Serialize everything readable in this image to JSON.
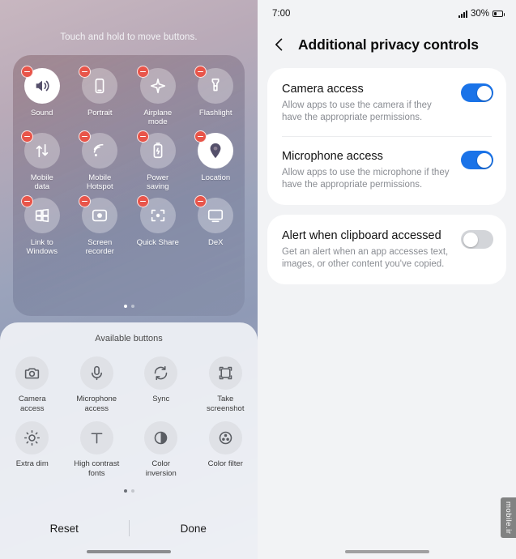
{
  "left_panel": {
    "hint": "Touch and hold to move buttons.",
    "quick_tiles": [
      {
        "label": "Sound",
        "icon": "sound-icon",
        "active": true,
        "removable": true
      },
      {
        "label": "Portrait",
        "icon": "portrait-rotation-icon",
        "active": false,
        "removable": true
      },
      {
        "label": "Airplane\nmode",
        "icon": "airplane-icon",
        "active": false,
        "removable": true
      },
      {
        "label": "Flashlight",
        "icon": "flashlight-icon",
        "active": false,
        "removable": true
      },
      {
        "label": "Mobile\ndata",
        "icon": "mobile-data-icon",
        "active": false,
        "removable": true
      },
      {
        "label": "Mobile\nHotspot",
        "icon": "hotspot-icon",
        "active": false,
        "removable": true
      },
      {
        "label": "Power\nsaving",
        "icon": "power-saving-icon",
        "active": false,
        "removable": true
      },
      {
        "label": "Location",
        "icon": "location-pin-icon",
        "active": true,
        "removable": true
      },
      {
        "label": "Link to\nWindows",
        "icon": "link-to-windows-icon",
        "active": false,
        "removable": true
      },
      {
        "label": "Screen\nrecorder",
        "icon": "screen-recorder-icon",
        "active": false,
        "removable": true
      },
      {
        "label": "Quick Share",
        "icon": "quick-share-icon",
        "active": false,
        "removable": true
      },
      {
        "label": "DeX",
        "icon": "dex-icon",
        "active": false,
        "removable": true
      }
    ],
    "page_dots": {
      "count": 2,
      "active_index": 0
    },
    "available_title": "Available buttons",
    "available_tiles": [
      {
        "label": "Camera\naccess",
        "icon": "camera-icon"
      },
      {
        "label": "Microphone\naccess",
        "icon": "microphone-icon"
      },
      {
        "label": "Sync",
        "icon": "sync-icon"
      },
      {
        "label": "Take\nscreenshot",
        "icon": "screenshot-icon"
      },
      {
        "label": "Extra dim",
        "icon": "extra-dim-icon"
      },
      {
        "label": "High contrast\nfonts",
        "icon": "high-contrast-fonts-icon"
      },
      {
        "label": "Color\ninversion",
        "icon": "color-inversion-icon"
      },
      {
        "label": "Color filter",
        "icon": "color-filter-icon"
      }
    ],
    "available_dots": {
      "count": 2,
      "active_index": 0
    },
    "reset_label": "Reset",
    "done_label": "Done"
  },
  "right_panel": {
    "status": {
      "time": "7:00",
      "battery": "30%"
    },
    "title": "Additional privacy controls",
    "back_icon": "chevron-left-icon",
    "settings": [
      {
        "title": "Camera access",
        "desc": "Allow apps to use the camera if they have the appropriate permissions.",
        "toggle": "on"
      },
      {
        "title": "Microphone access",
        "desc": "Allow apps to use the microphone if they have the appropriate permissions.",
        "toggle": "on"
      },
      {
        "title": "Alert when clipboard accessed",
        "desc": "Get an alert when an app accesses text, images, or other content you've copied.",
        "toggle": "off"
      }
    ],
    "watermark": "mobile.ir",
    "accent_color": "#1a73e8"
  }
}
